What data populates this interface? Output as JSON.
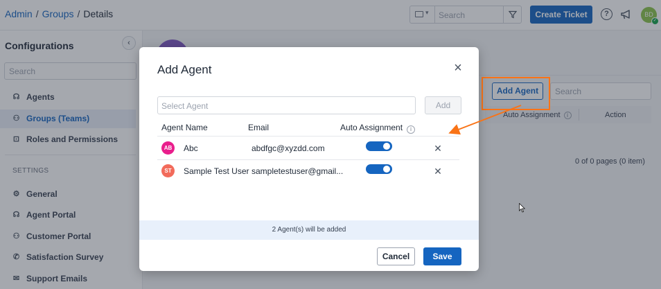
{
  "breadcrumb": {
    "root": "Admin",
    "section": "Groups",
    "current": "Details",
    "separator": "/"
  },
  "header": {
    "search_placeholder": "Search",
    "create_ticket": "Create Ticket",
    "avatar_initials": "BD",
    "help": "?"
  },
  "sidebar": {
    "title": "Configurations",
    "collapse_glyph": "‹",
    "search_placeholder": "Search",
    "items": [
      {
        "label": "Agents",
        "glyph": "☊"
      },
      {
        "label": "Groups (Teams)",
        "glyph": "⚇"
      },
      {
        "label": "Roles and Permissions",
        "glyph": "⊡"
      }
    ],
    "settings_heading": "SETTINGS",
    "settings_items": [
      {
        "label": "General",
        "glyph": "⚙"
      },
      {
        "label": "Agent Portal",
        "glyph": "☊"
      },
      {
        "label": "Customer Portal",
        "glyph": "⚇"
      },
      {
        "label": "Satisfaction Survey",
        "glyph": "✆"
      },
      {
        "label": "Support Emails",
        "glyph": "✉"
      }
    ]
  },
  "main": {
    "add_agent": "Add Agent",
    "search_placeholder": "Search",
    "columns": {
      "auto_assignment": "Auto Assignment",
      "action": "Action"
    },
    "pagination": "0 of 0 pages (0 item)"
  },
  "modal": {
    "title": "Add Agent",
    "select_placeholder": "Select Agent",
    "add_button": "Add",
    "columns": {
      "name": "Agent Name",
      "email": "Email",
      "auto": "Auto Assignment"
    },
    "rows": [
      {
        "initials": "AB",
        "name": "Abc",
        "email": "abdfgc@xyzdd.com",
        "auto_assign": true,
        "color": "#e91e8c"
      },
      {
        "initials": "ST",
        "name": "Sample Test User",
        "email": "sampletestuser@gmail...",
        "auto_assign": true,
        "color": "#f26b5b"
      }
    ],
    "info": "2 Agent(s) will be added",
    "cancel": "Cancel",
    "save": "Save"
  },
  "colors": {
    "primary": "#1565c0",
    "highlight": "#f97316"
  }
}
